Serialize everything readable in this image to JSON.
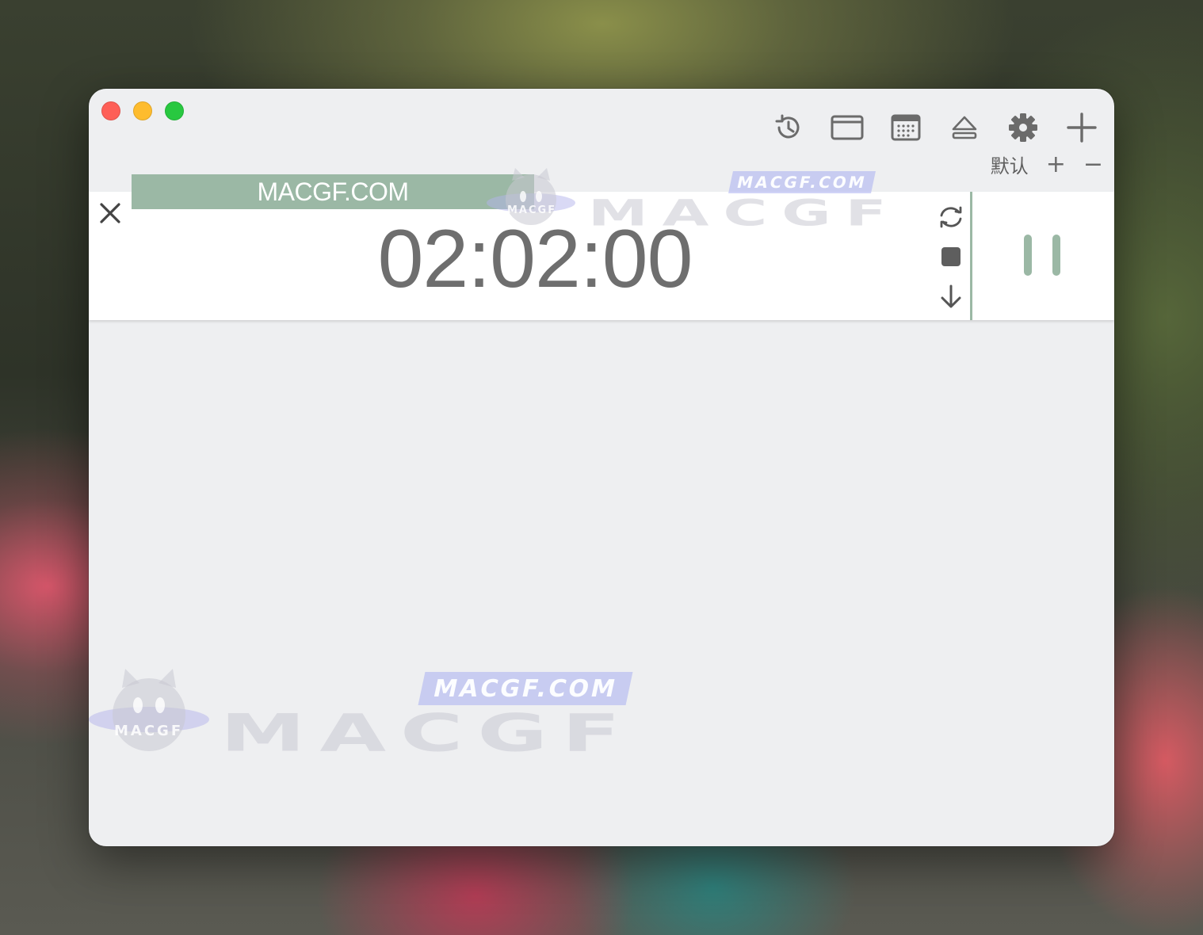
{
  "window": {
    "traffic_lights": {
      "close_color": "#fe5f57",
      "minimize_color": "#febc2e",
      "zoom_color": "#28c840"
    },
    "toolbar": {
      "icons": [
        "history-icon",
        "window-icon",
        "calendar-icon",
        "eject-icon",
        "gear-icon",
        "plus-icon"
      ]
    },
    "profile": {
      "label": "默认",
      "add": "+",
      "remove": "−"
    }
  },
  "timer": {
    "label": "MACGF.COM",
    "time": "02:02:00",
    "accent": "#9bb8a5",
    "controls": [
      "refresh-icon",
      "stop-icon",
      "arrow-down-icon"
    ],
    "pause_icon": "pause-icon"
  },
  "watermarks": {
    "tag": "MACGF.COM",
    "big": "MACGF",
    "mascot": "MACGF"
  }
}
